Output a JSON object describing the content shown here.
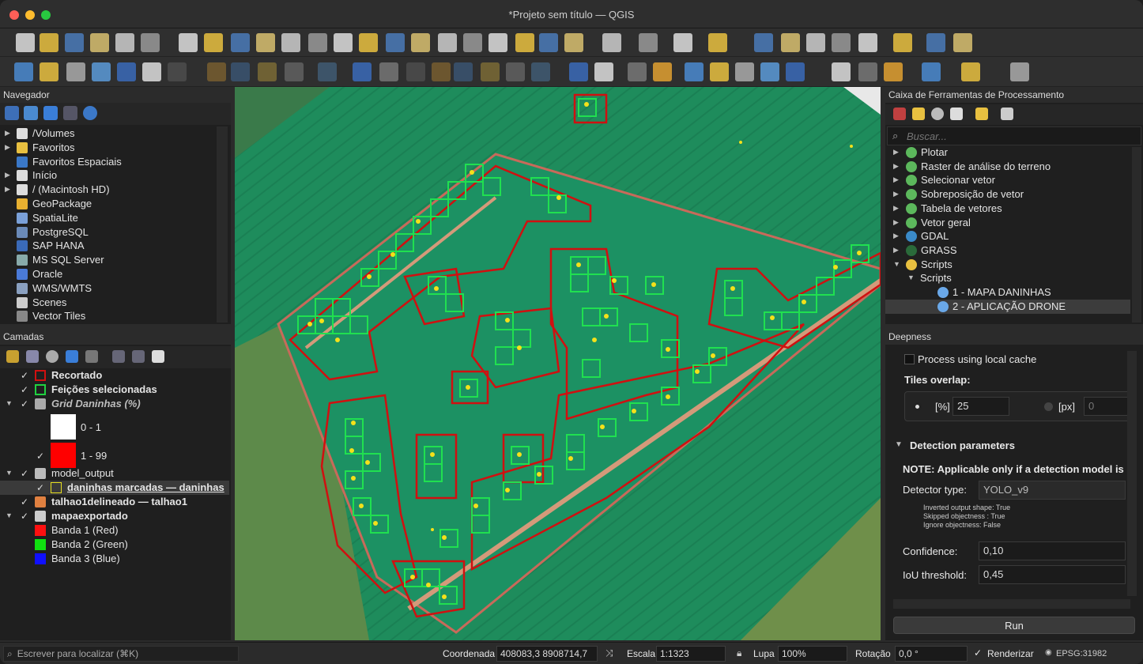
{
  "window": {
    "title": "*Projeto sem título — QGIS"
  },
  "navigator": {
    "title": "Navegador",
    "items": [
      {
        "label": "/Volumes",
        "icon": "folder-icon"
      },
      {
        "label": "Favoritos",
        "icon": "star-icon"
      },
      {
        "label": "Favoritos Espaciais",
        "icon": "spatial-bookmark-icon"
      },
      {
        "label": "Início",
        "icon": "folder-icon"
      },
      {
        "label": "/ (Macintosh HD)",
        "icon": "folder-icon"
      },
      {
        "label": "GeoPackage",
        "icon": "geopackage-icon"
      },
      {
        "label": "SpatiaLite",
        "icon": "spatialite-icon"
      },
      {
        "label": "PostgreSQL",
        "icon": "postgresql-icon"
      },
      {
        "label": "SAP HANA",
        "icon": "sap-hana-icon"
      },
      {
        "label": "MS SQL Server",
        "icon": "mssql-icon"
      },
      {
        "label": "Oracle",
        "icon": "oracle-icon"
      },
      {
        "label": "WMS/WMTS",
        "icon": "wms-icon"
      },
      {
        "label": "Scenes",
        "icon": "scenes-icon"
      },
      {
        "label": "Vector Tiles",
        "icon": "vector-tiles-icon"
      }
    ]
  },
  "layers": {
    "title": "Camadas",
    "items": [
      {
        "label": "Recortado",
        "checked": "✓",
        "bold": true,
        "swatch": "#d01010"
      },
      {
        "label": "Feições selecionadas",
        "checked": "✓",
        "bold": true,
        "swatch": "#20d040"
      },
      {
        "label": "Grid Daninhas (%)",
        "checked": "✓",
        "bold": true
      },
      {
        "label": "0 - 1",
        "checked": "",
        "swatch": "#ffffff"
      },
      {
        "label": "1 - 99",
        "checked": "✓",
        "swatch": "#ff0000"
      },
      {
        "label": "model_output",
        "checked": "✓"
      },
      {
        "label": "daninhas marcadas — daninhas",
        "checked": "✓",
        "bold": true
      },
      {
        "label": "talhao1delineado — talhao1",
        "checked": "✓",
        "bold": true
      },
      {
        "label": "mapaexportado",
        "checked": "✓",
        "bold": true
      },
      {
        "label": "Banda 1 (Red)",
        "swatch": "#ff1010"
      },
      {
        "label": "Banda 2 (Green)",
        "swatch": "#10e010"
      },
      {
        "label": "Banda 3 (Blue)",
        "swatch": "#1010ff"
      }
    ]
  },
  "processing": {
    "title": "Caixa de Ferramentas de Processamento",
    "search_placeholder": "Buscar...",
    "items": [
      {
        "label": "Plotar"
      },
      {
        "label": "Raster de análise do terreno"
      },
      {
        "label": "Selecionar vetor"
      },
      {
        "label": "Sobreposição de vetor"
      },
      {
        "label": "Tabela de vetores"
      },
      {
        "label": "Vetor geral"
      },
      {
        "label": "GDAL"
      },
      {
        "label": "GRASS"
      },
      {
        "label": "Scripts"
      },
      {
        "label": "Scripts"
      },
      {
        "label": "1 - MAPA DANINHAS"
      },
      {
        "label": "2 - APLICAÇÃO DRONE"
      }
    ]
  },
  "deepness": {
    "title": "Deepness",
    "process_cache": "Process using local cache",
    "tiles_overlap": "Tiles overlap:",
    "pct_label": "[%]",
    "pct_value": "25",
    "px_label": "[px]",
    "px_value": "0",
    "detection_header": "Detection parameters",
    "note": "NOTE: Applicable only if a detection model is",
    "detector_label": "Detector type:",
    "detector_value": "YOLO_v9",
    "info1": "Inverted output shape: True",
    "info2": "Skipped objectness : True",
    "info3": "Ignore objectness: False",
    "confidence_label": "Confidence:",
    "confidence_value": "0,10",
    "iou_label": "IoU threshold:",
    "iou_value": "0,45",
    "run": "Run"
  },
  "status": {
    "locator_placeholder": "Escrever para localizar (⌘K)",
    "coord_label": "Coordenada",
    "coord_value": "408083,3  8908714,7",
    "scale_label": "Escala",
    "scale_value": "1:1323",
    "zoom_label": "Lupa",
    "zoom_value": "100%",
    "rotation_label": "Rotação",
    "rotation_value": "0,0 °",
    "render_label": "Renderizar",
    "crs": "EPSG:31982"
  }
}
